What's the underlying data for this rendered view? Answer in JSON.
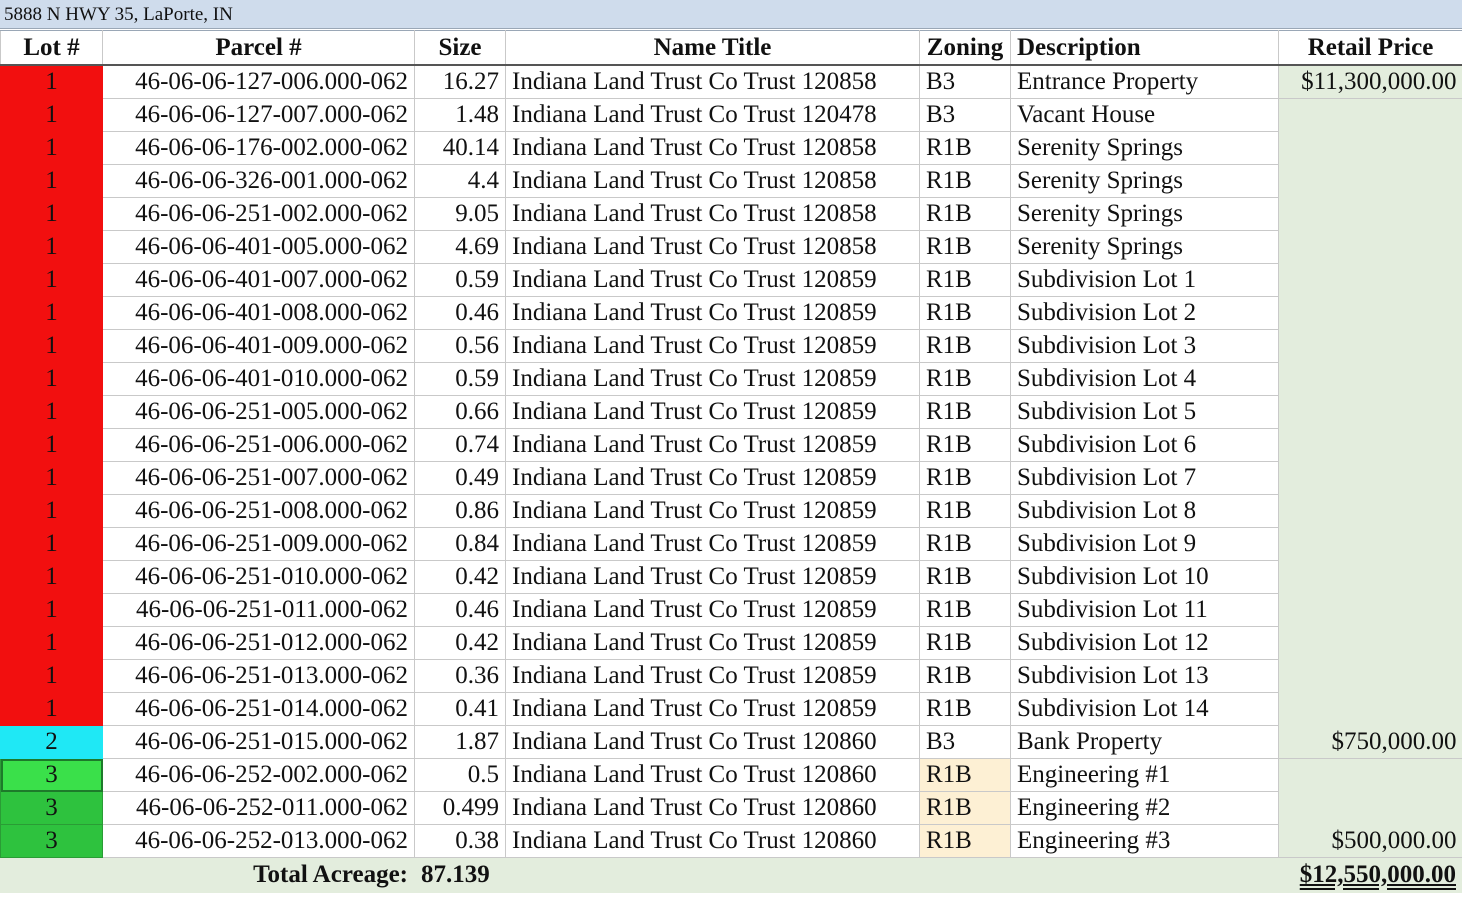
{
  "title": "5888 N HWY 35, LaPorte, IN",
  "headers": [
    "Lot #",
    "Parcel #",
    "Size",
    "Name Title",
    "Zoning",
    "Description",
    "Retail Price"
  ],
  "rows": [
    {
      "lot": "1",
      "parcel": "46-06-06-127-006.000-062",
      "size": "16.27",
      "name": "Indiana Land Trust Co Trust 120858",
      "zoning": "B3",
      "desc": "Entrance Property",
      "price": "$11,300,000.00"
    },
    {
      "lot": "1",
      "parcel": "46-06-06-127-007.000-062",
      "size": "1.48",
      "name": "Indiana Land Trust Co Trust 120478",
      "zoning": "B3",
      "desc": "Vacant House",
      "price": ""
    },
    {
      "lot": "1",
      "parcel": "46-06-06-176-002.000-062",
      "size": "40.14",
      "name": "Indiana Land Trust Co Trust 120858",
      "zoning": "R1B",
      "desc": "Serenity Springs",
      "price": ""
    },
    {
      "lot": "1",
      "parcel": "46-06-06-326-001.000-062",
      "size": "4.4",
      "name": "Indiana Land Trust Co Trust 120858",
      "zoning": "R1B",
      "desc": "Serenity Springs",
      "price": ""
    },
    {
      "lot": "1",
      "parcel": "46-06-06-251-002.000-062",
      "size": "9.05",
      "name": "Indiana Land Trust Co Trust 120858",
      "zoning": "R1B",
      "desc": "Serenity Springs",
      "price": ""
    },
    {
      "lot": "1",
      "parcel": "46-06-06-401-005.000-062",
      "size": "4.69",
      "name": "Indiana Land Trust Co Trust 120858",
      "zoning": "R1B",
      "desc": "Serenity Springs",
      "price": ""
    },
    {
      "lot": "1",
      "parcel": "46-06-06-401-007.000-062",
      "size": "0.59",
      "name": "Indiana Land Trust Co Trust 120859",
      "zoning": "R1B",
      "desc": "Subdivision Lot 1",
      "price": ""
    },
    {
      "lot": "1",
      "parcel": "46-06-06-401-008.000-062",
      "size": "0.46",
      "name": "Indiana Land Trust Co Trust 120859",
      "zoning": "R1B",
      "desc": "Subdivision Lot 2",
      "price": ""
    },
    {
      "lot": "1",
      "parcel": "46-06-06-401-009.000-062",
      "size": "0.56",
      "name": "Indiana Land Trust Co Trust 120859",
      "zoning": "R1B",
      "desc": "Subdivision Lot 3",
      "price": ""
    },
    {
      "lot": "1",
      "parcel": "46-06-06-401-010.000-062",
      "size": "0.59",
      "name": "Indiana Land Trust Co Trust 120859",
      "zoning": "R1B",
      "desc": "Subdivision Lot 4",
      "price": ""
    },
    {
      "lot": "1",
      "parcel": "46-06-06-251-005.000-062",
      "size": "0.66",
      "name": "Indiana Land Trust Co Trust 120859",
      "zoning": "R1B",
      "desc": "Subdivision Lot 5",
      "price": ""
    },
    {
      "lot": "1",
      "parcel": "46-06-06-251-006.000-062",
      "size": "0.74",
      "name": "Indiana Land Trust Co Trust 120859",
      "zoning": "R1B",
      "desc": "Subdivision Lot 6",
      "price": ""
    },
    {
      "lot": "1",
      "parcel": "46-06-06-251-007.000-062",
      "size": "0.49",
      "name": "Indiana Land Trust Co Trust 120859",
      "zoning": "R1B",
      "desc": "Subdivision Lot 7",
      "price": ""
    },
    {
      "lot": "1",
      "parcel": "46-06-06-251-008.000-062",
      "size": "0.86",
      "name": "Indiana Land Trust Co Trust 120859",
      "zoning": "R1B",
      "desc": "Subdivision Lot 8",
      "price": ""
    },
    {
      "lot": "1",
      "parcel": "46-06-06-251-009.000-062",
      "size": "0.84",
      "name": "Indiana Land Trust Co Trust 120859",
      "zoning": "R1B",
      "desc": "Subdivision Lot 9",
      "price": ""
    },
    {
      "lot": "1",
      "parcel": "46-06-06-251-010.000-062",
      "size": "0.42",
      "name": "Indiana Land Trust Co Trust 120859",
      "zoning": "R1B",
      "desc": "Subdivision Lot 10",
      "price": ""
    },
    {
      "lot": "1",
      "parcel": "46-06-06-251-011.000-062",
      "size": "0.46",
      "name": "Indiana Land Trust Co Trust 120859",
      "zoning": "R1B",
      "desc": "Subdivision Lot 11",
      "price": ""
    },
    {
      "lot": "1",
      "parcel": "46-06-06-251-012.000-062",
      "size": "0.42",
      "name": "Indiana Land Trust Co Trust 120859",
      "zoning": "R1B",
      "desc": "Subdivision Lot 12",
      "price": ""
    },
    {
      "lot": "1",
      "parcel": "46-06-06-251-013.000-062",
      "size": "0.36",
      "name": "Indiana Land Trust Co Trust 120859",
      "zoning": "R1B",
      "desc": "Subdivision Lot 13",
      "price": ""
    },
    {
      "lot": "1",
      "parcel": "46-06-06-251-014.000-062",
      "size": "0.41",
      "name": "Indiana Land Trust Co Trust 120859",
      "zoning": "R1B",
      "desc": "Subdivision Lot 14",
      "price": ""
    },
    {
      "lot": "2",
      "parcel": "46-06-06-251-015.000-062",
      "size": "1.87",
      "name": "Indiana Land Trust Co Trust 120860",
      "zoning": "B3",
      "desc": "Bank Property",
      "price": "$750,000.00"
    },
    {
      "lot": "3",
      "parcel": "46-06-06-252-002.000-062",
      "size": "0.5",
      "name": "Indiana Land Trust Co Trust 120860",
      "zoning": "R1B",
      "desc": "Engineering #1",
      "price": ""
    },
    {
      "lot": "3",
      "parcel": "46-06-06-252-011.000-062",
      "size": "0.499",
      "name": "Indiana Land Trust Co Trust 120860",
      "zoning": "R1B",
      "desc": "Engineering #2",
      "price": ""
    },
    {
      "lot": "3",
      "parcel": "46-06-06-252-013.000-062",
      "size": "0.38",
      "name": "Indiana Land Trust Co Trust 120860",
      "zoning": "R1B",
      "desc": "Engineering #3",
      "price": "$500,000.00"
    }
  ],
  "total": {
    "label": "Total Acreage:",
    "acreage": "87.139",
    "price": "$12,550,000.00"
  },
  "colors": {
    "lot1": "#f20f0f",
    "lot2": "#1fe8f5",
    "lot3": "#2ec23e",
    "price_bg": "#e3eddd",
    "zoning_highlight": "#fdf0d4"
  }
}
